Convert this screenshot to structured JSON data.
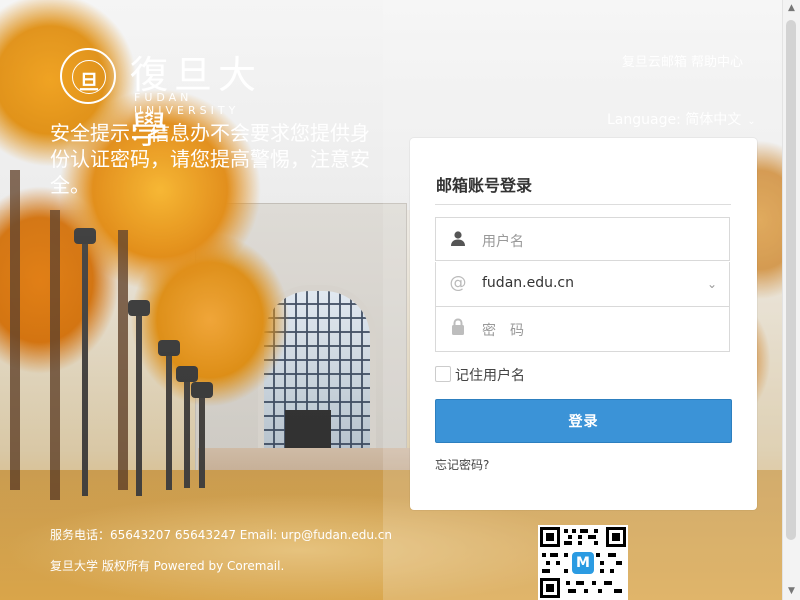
{
  "header": {
    "logo": {
      "seal_text": "旦",
      "title": "復旦大學",
      "subtitle": "FUDAN UNIVERSITY"
    },
    "links": "复旦云邮箱 帮助中心",
    "language_label": "Language: 简体中文",
    "language_icon": "chevron-down-icon"
  },
  "notice": {
    "text": "安全提示：信息办不会要求您提供身份认证密码，请您提高警惕，注意安全。"
  },
  "login": {
    "title": "邮箱账号登录",
    "username_placeholder": "用户名",
    "domain_value": "fudan.edu.cn",
    "password_placeholder": "密　码",
    "remember_label": "记住用户名",
    "submit_label": "登录",
    "forgot_label": "忘记密码?",
    "icons": {
      "user": "user-icon",
      "at": "at-icon",
      "lock": "lock-icon",
      "dropdown": "chevron-down-icon"
    }
  },
  "footer": {
    "line1": "服务电话：65643207 65643247 Email: urp@fudan.edu.cn",
    "line2": "复旦大学 版权所有  Powered by Coremail."
  },
  "qr": {
    "center_text": "M"
  },
  "colors": {
    "primary": "#3b93d7",
    "panel_bg": "#ffffff",
    "text_dark": "#333333"
  }
}
